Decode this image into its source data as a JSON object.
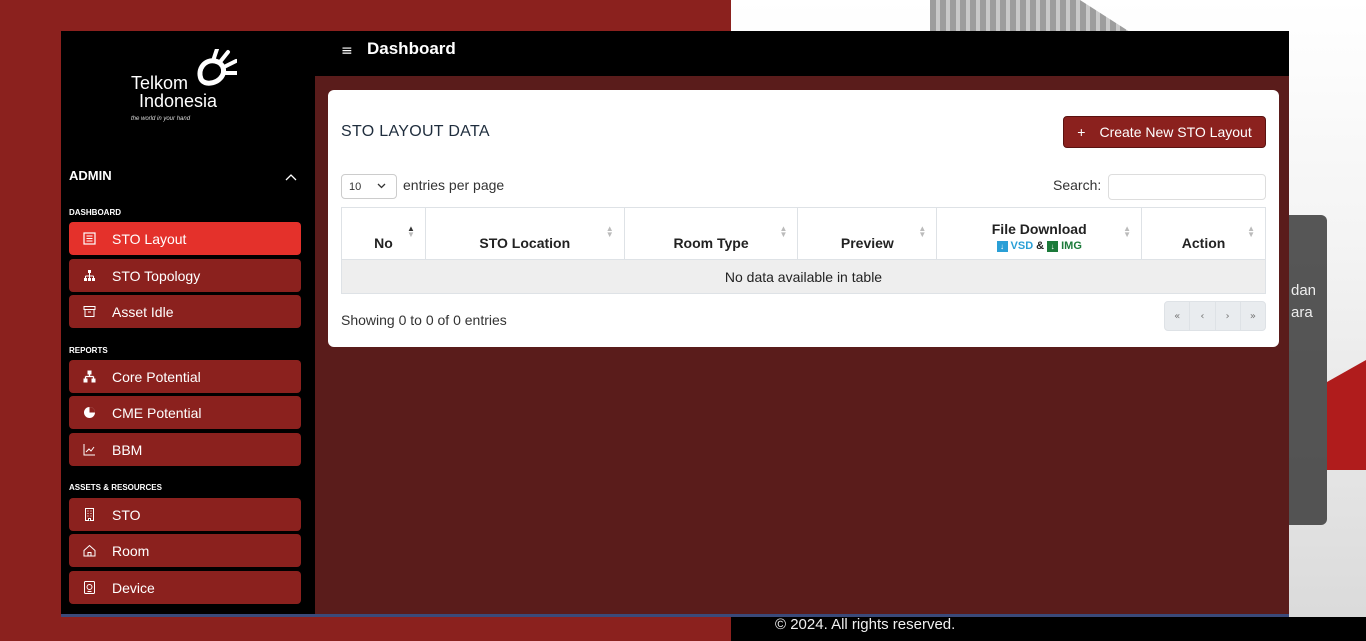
{
  "app": {
    "brand_line1": "Telkom",
    "brand_line2": "Indonesia",
    "brand_tagline": "the world in your hand",
    "header_title": "Dashboard",
    "footer": "© 2024. All rights reserved.",
    "background_fragments": [
      "dan",
      "ara"
    ]
  },
  "sidebar": {
    "user_section": "ADMIN",
    "groups": [
      {
        "title": "DASHBOARD",
        "items": [
          {
            "label": "STO Layout",
            "icon": "document-list-icon",
            "active": true
          },
          {
            "label": "STO Topology",
            "icon": "network-tree-icon",
            "active": false
          },
          {
            "label": "Asset Idle",
            "icon": "archive-box-icon",
            "active": false
          }
        ]
      },
      {
        "title": "REPORTS",
        "items": [
          {
            "label": "Core Potential",
            "icon": "sitemap-icon",
            "active": false
          },
          {
            "label": "CME Potential",
            "icon": "pie-chart-icon",
            "active": false
          },
          {
            "label": "BBM",
            "icon": "line-chart-icon",
            "active": false
          }
        ]
      },
      {
        "title": "ASSETS & RESOURCES",
        "items": [
          {
            "label": "STO",
            "icon": "building-icon",
            "active": false
          },
          {
            "label": "Room",
            "icon": "home-icon",
            "active": false
          },
          {
            "label": "Device",
            "icon": "device-icon",
            "active": false
          }
        ]
      }
    ]
  },
  "card": {
    "title": "STO LAYOUT DATA",
    "create_button": "Create New STO Layout",
    "create_plus": "+",
    "page_length": "10",
    "page_length_text": "entries per page",
    "search_label": "Search:",
    "search_value": "",
    "columns": [
      "No",
      "STO Location",
      "Room Type",
      "Preview",
      "File Download",
      "Action"
    ],
    "file_download_sub": {
      "vsd": "VSD",
      "amp": "&",
      "img": "IMG"
    },
    "empty_message": "No data available in table",
    "info": "Showing 0 to 0 of 0 entries",
    "pager": [
      "«",
      "‹",
      "›",
      "»"
    ]
  },
  "colors": {
    "brand_red": "#8b211e",
    "active_red": "#e4312b",
    "content_bg": "#5a1c1b"
  }
}
